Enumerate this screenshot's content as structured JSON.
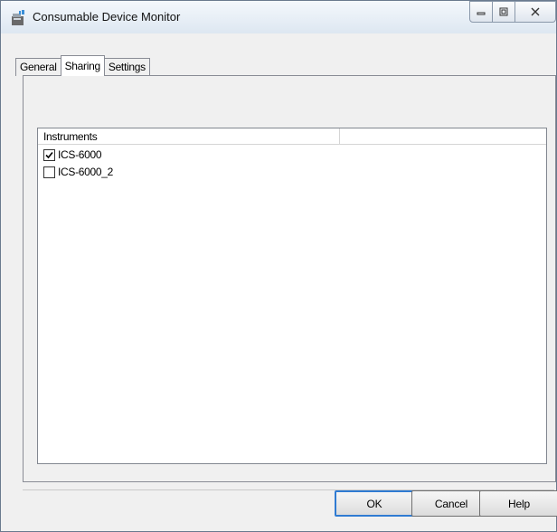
{
  "window": {
    "title": "Consumable Device Monitor",
    "icon": "app-icon",
    "caption_buttons": [
      "minimize-icon",
      "maximize-icon",
      "close-icon"
    ]
  },
  "tabs": [
    {
      "label": "General",
      "active": false
    },
    {
      "label": "Sharing",
      "active": true
    },
    {
      "label": "Settings",
      "active": false
    }
  ],
  "instruments": {
    "columns": [
      "Instruments",
      ""
    ],
    "rows": [
      {
        "label": "ICS-6000",
        "checked": true
      },
      {
        "label": "ICS-6000_2",
        "checked": false
      }
    ]
  },
  "buttons": {
    "ok": "OK",
    "cancel": "Cancel",
    "help": "Help"
  }
}
